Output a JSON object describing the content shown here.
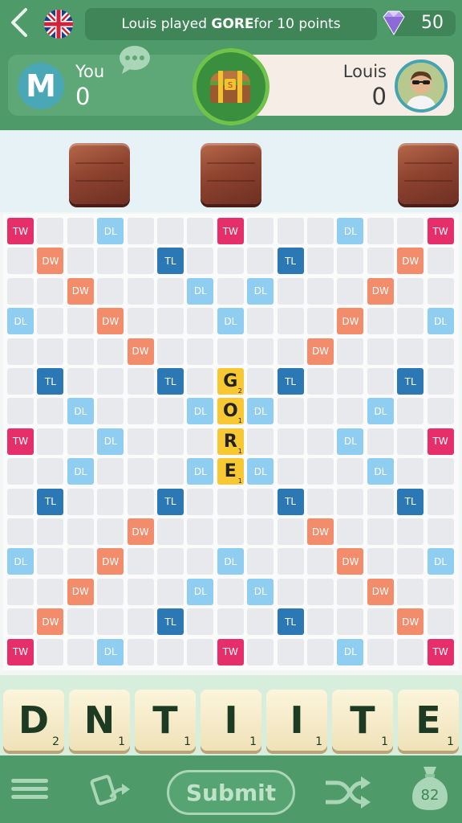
{
  "header": {
    "back_icon": "chevron-left-icon",
    "flag_icon": "uk-flag-icon",
    "banner": {
      "prefix": "Louis played ",
      "word": "GORE",
      "suffix": " for 10 points"
    },
    "gem_icon": "diamond-icon",
    "gems": "50"
  },
  "scores": {
    "me": {
      "initial": "M",
      "name": "You",
      "score": "0"
    },
    "chest_icon": "treasure-chest-icon",
    "chat_icon": "chat-bubble-icon",
    "opponent": {
      "name": "Louis",
      "score": "0",
      "avatar_icon": "profile-photo"
    }
  },
  "opponent_rack_tiles": 3,
  "board": {
    "size": 15,
    "premium": [
      "TW,,,DL,,,,TW,,,,DL,,,TW",
      ",DW,,,,TL,,,,TL,,,,DW,",
      ",,DW,,,,DL,,DL,,,,DW,,",
      "DL,,,DW,,,,DL,,,,DW,,,DL",
      ",,,,DW,,,,,,DW,,,,",
      ",TL,,,,TL,,,,TL,,,,TL,",
      ",,DL,,,,DL,,DL,,,,DL,,",
      "TW,,,DL,,,,,,,,DL,,,TW",
      ",,DL,,,,DL,,DL,,,,DL,,",
      ",TL,,,,TL,,,,TL,,,,TL,",
      ",,,,DW,,,,,,DW,,,,",
      "DL,,,DW,,,,DL,,,,DW,,,DL",
      ",,DW,,,,DL,,DL,,,,DW,,",
      ",DW,,,,TL,,,,TL,,,,DW,",
      "TW,,,DL,,,,TW,,,,DL,,,TW"
    ],
    "played": [
      {
        "letter": "G",
        "points": "2",
        "row": 5,
        "col": 7
      },
      {
        "letter": "O",
        "points": "1",
        "row": 6,
        "col": 7
      },
      {
        "letter": "R",
        "points": "1",
        "row": 7,
        "col": 7
      },
      {
        "letter": "E",
        "points": "1",
        "row": 8,
        "col": 7
      }
    ]
  },
  "rack": [
    {
      "letter": "D",
      "points": "2"
    },
    {
      "letter": "N",
      "points": "1"
    },
    {
      "letter": "T",
      "points": "1"
    },
    {
      "letter": "I",
      "points": "1"
    },
    {
      "letter": "I",
      "points": "1"
    },
    {
      "letter": "T",
      "points": "1"
    },
    {
      "letter": "E",
      "points": "1"
    }
  ],
  "footer": {
    "menu_icon": "hamburger-menu-icon",
    "swap_icon": "swap-tiles-icon",
    "submit_label": "Submit",
    "shuffle_icon": "shuffle-icon",
    "bag_icon": "tile-bag-icon",
    "tiles_left": "82"
  },
  "colors": {
    "header_green": "#4f9a69",
    "triple_word": "#e62e6b",
    "double_word": "#f28c6b",
    "triple_letter": "#2c78b4",
    "double_letter": "#8fcdf1",
    "board_tile": "#f8c832"
  }
}
